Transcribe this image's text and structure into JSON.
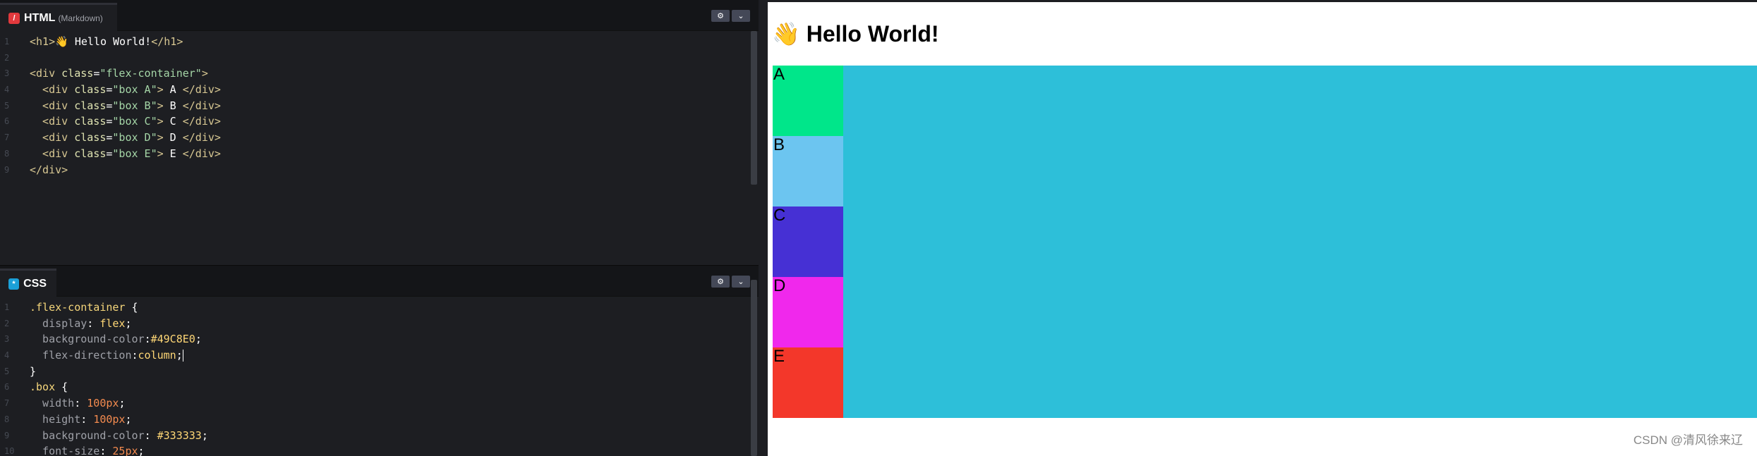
{
  "html_editor": {
    "tab_title": "HTML",
    "tab_subtitle": "(Markdown)",
    "icon_letter": "/",
    "settings_icon": "⚙",
    "collapse_icon": "⌄",
    "lines": [
      {
        "n": "1",
        "parts": [
          {
            "c": "t-tag",
            "t": "<h1>"
          },
          {
            "c": "t-text",
            "t": "👋 Hello World!"
          },
          {
            "c": "t-tag",
            "t": "</h1>"
          }
        ]
      },
      {
        "n": "2",
        "parts": []
      },
      {
        "n": "3",
        "parts": [
          {
            "c": "t-tag",
            "t": "<div "
          },
          {
            "c": "t-attr",
            "t": "class"
          },
          {
            "c": "t-text",
            "t": "="
          },
          {
            "c": "t-str2",
            "t": "\"flex-container\""
          },
          {
            "c": "t-tag",
            "t": ">"
          }
        ]
      },
      {
        "n": "4",
        "parts": [
          {
            "c": "t-tag",
            "t": "  <div "
          },
          {
            "c": "t-attr",
            "t": "class"
          },
          {
            "c": "t-text",
            "t": "="
          },
          {
            "c": "t-str2",
            "t": "\"box A\""
          },
          {
            "c": "t-tag",
            "t": ">"
          },
          {
            "c": "t-text",
            "t": " A "
          },
          {
            "c": "t-tag",
            "t": "</div>"
          }
        ]
      },
      {
        "n": "5",
        "parts": [
          {
            "c": "t-tag",
            "t": "  <div "
          },
          {
            "c": "t-attr",
            "t": "class"
          },
          {
            "c": "t-text",
            "t": "="
          },
          {
            "c": "t-str2",
            "t": "\"box B\""
          },
          {
            "c": "t-tag",
            "t": ">"
          },
          {
            "c": "t-text",
            "t": " B "
          },
          {
            "c": "t-tag",
            "t": "</div>"
          }
        ]
      },
      {
        "n": "6",
        "parts": [
          {
            "c": "t-tag",
            "t": "  <div "
          },
          {
            "c": "t-attr",
            "t": "class"
          },
          {
            "c": "t-text",
            "t": "="
          },
          {
            "c": "t-str2",
            "t": "\"box C\""
          },
          {
            "c": "t-tag",
            "t": ">"
          },
          {
            "c": "t-text",
            "t": " C "
          },
          {
            "c": "t-tag",
            "t": "</div>"
          }
        ]
      },
      {
        "n": "7",
        "parts": [
          {
            "c": "t-tag",
            "t": "  <div "
          },
          {
            "c": "t-attr",
            "t": "class"
          },
          {
            "c": "t-text",
            "t": "="
          },
          {
            "c": "t-str2",
            "t": "\"box D\""
          },
          {
            "c": "t-tag",
            "t": ">"
          },
          {
            "c": "t-text",
            "t": " D "
          },
          {
            "c": "t-tag",
            "t": "</div>"
          }
        ]
      },
      {
        "n": "8",
        "parts": [
          {
            "c": "t-tag",
            "t": "  <div "
          },
          {
            "c": "t-attr",
            "t": "class"
          },
          {
            "c": "t-text",
            "t": "="
          },
          {
            "c": "t-str2",
            "t": "\"box E\""
          },
          {
            "c": "t-tag",
            "t": ">"
          },
          {
            "c": "t-text",
            "t": " E "
          },
          {
            "c": "t-tag",
            "t": "</div>"
          }
        ]
      },
      {
        "n": "9",
        "parts": [
          {
            "c": "t-tag",
            "t": "</div>"
          }
        ]
      }
    ]
  },
  "css_editor": {
    "tab_title": "CSS",
    "icon_letter": "*",
    "settings_icon": "⚙",
    "collapse_icon": "⌄",
    "lines": [
      {
        "n": "1",
        "parts": [
          {
            "c": "t-sel",
            "t": ".flex-container "
          },
          {
            "c": "t-punc",
            "t": "{"
          }
        ]
      },
      {
        "n": "2",
        "parts": [
          {
            "c": "t-prop",
            "t": "  display"
          },
          {
            "c": "t-punc",
            "t": ": "
          },
          {
            "c": "t-val",
            "t": "flex"
          },
          {
            "c": "t-punc",
            "t": ";"
          }
        ]
      },
      {
        "n": "3",
        "parts": [
          {
            "c": "t-prop",
            "t": "  background-color"
          },
          {
            "c": "t-punc",
            "t": ":"
          },
          {
            "c": "t-val",
            "t": "#49C8E0"
          },
          {
            "c": "t-punc",
            "t": ";"
          }
        ]
      },
      {
        "n": "4",
        "parts": [
          {
            "c": "t-prop",
            "t": "  flex-direction"
          },
          {
            "c": "t-punc",
            "t": ":"
          },
          {
            "c": "t-val",
            "t": "column"
          },
          {
            "c": "t-punc",
            "t": ";"
          }
        ],
        "cursor": true
      },
      {
        "n": "5",
        "parts": [
          {
            "c": "t-punc",
            "t": "}"
          }
        ]
      },
      {
        "n": "6",
        "parts": [
          {
            "c": "t-sel",
            "t": ".box "
          },
          {
            "c": "t-punc",
            "t": "{"
          }
        ]
      },
      {
        "n": "7",
        "parts": [
          {
            "c": "t-prop",
            "t": "  width"
          },
          {
            "c": "t-punc",
            "t": ": "
          },
          {
            "c": "t-num",
            "t": "100px"
          },
          {
            "c": "t-punc",
            "t": ";"
          }
        ]
      },
      {
        "n": "8",
        "parts": [
          {
            "c": "t-prop",
            "t": "  height"
          },
          {
            "c": "t-punc",
            "t": ": "
          },
          {
            "c": "t-num",
            "t": "100px"
          },
          {
            "c": "t-punc",
            "t": ";"
          }
        ]
      },
      {
        "n": "9",
        "parts": [
          {
            "c": "t-prop",
            "t": "  background-color"
          },
          {
            "c": "t-punc",
            "t": ": "
          },
          {
            "c": "t-val",
            "t": "#333333"
          },
          {
            "c": "t-punc",
            "t": ";"
          }
        ]
      },
      {
        "n": "10",
        "parts": [
          {
            "c": "t-prop",
            "t": "  font-size"
          },
          {
            "c": "t-punc",
            "t": ": "
          },
          {
            "c": "t-num",
            "t": "25px"
          },
          {
            "c": "t-punc",
            "t": ";"
          }
        ]
      }
    ]
  },
  "preview": {
    "heading": "👋 Hello World!",
    "container_color": "#2dbfd9",
    "boxes": [
      {
        "label": "A",
        "color": "#00e68a"
      },
      {
        "label": "B",
        "color": "#6cc5f0"
      },
      {
        "label": "C",
        "color": "#4630d4"
      },
      {
        "label": "D",
        "color": "#f028ec"
      },
      {
        "label": "E",
        "color": "#f3372a"
      }
    ]
  },
  "watermark": "CSDN @清风徐来辽"
}
